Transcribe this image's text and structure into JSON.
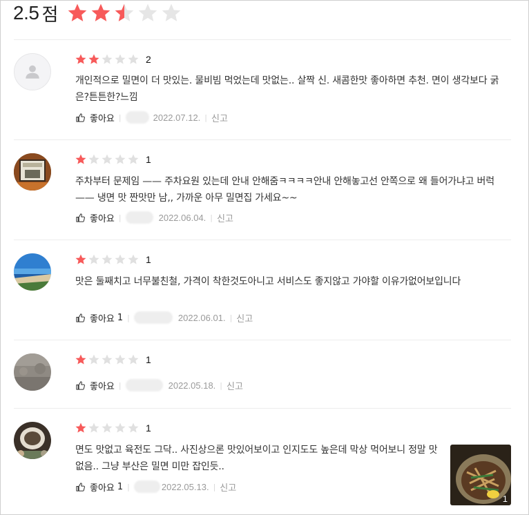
{
  "summary": {
    "score": "2.5",
    "unit": "점",
    "rating": 2.5,
    "max": 5
  },
  "colors": {
    "star_on": "#f75a5a",
    "star_off": "#e0e0e0",
    "big_star_off": "#e6e6e6"
  },
  "like_label": "좋아요",
  "report_label": "신고",
  "reviews": [
    {
      "rating": 2,
      "score": "2",
      "text": "개인적으로 밀면이 더 맛있는. 물비빔 먹었는데 맛없는.. 살짝 신. 새콤한맛 좋아하면 추천. 면이 생각보다 굵은?튼튼한?느낌",
      "like_count": "",
      "date": "2022.07.12.",
      "avatar": "default-avatar-icon"
    },
    {
      "rating": 1,
      "score": "1",
      "text": "주차부터 문제임 —— 주차요원 있는데 안내 안해줌ㅋㅋㅋㅋ안내 안해놓고선 안쪽으로 왜 들어가냐고 버럭 —— 냉면 맛 짠맛만 남,, 가까운 아무 밀면집 가세요~~",
      "like_count": "",
      "date": "2022.06.04.",
      "avatar": "framed-picture-photo"
    },
    {
      "rating": 1,
      "score": "1",
      "text": "맛은 둘째치고 너무불친철, 가격이 착한것도아니고 서비스도 좋지않고 가야할 이유가없어보입니다",
      "like_count": "1",
      "date": "2022.06.01.",
      "avatar": "beach-photo"
    },
    {
      "rating": 1,
      "score": "1",
      "text": "",
      "like_count": "",
      "date": "2022.05.18.",
      "avatar": "stone-texture-photo"
    },
    {
      "rating": 1,
      "score": "1",
      "text": "면도 맛없고 육전도 그닥.. 사진상으론 맛있어보이고 인지도도 높은데 막상 먹어보니 정말 맛없음.. 그냥 부산은  밀면 미만 잡인듯..",
      "like_count": "1",
      "date": "2022.05.13.",
      "avatar": "food-bowl-photo",
      "photo_count": "1"
    }
  ]
}
